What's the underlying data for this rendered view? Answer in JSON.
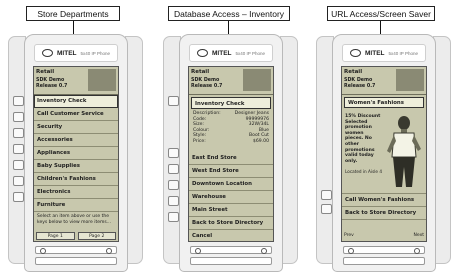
{
  "callouts": {
    "left": "Store Departments",
    "mid": "Database Access – Inventory",
    "right": "URL Access/Screen Saver"
  },
  "brand": {
    "logo": "MITEL",
    "model": "5x40 IP Phone"
  },
  "phone1": {
    "header": {
      "title": "Retail",
      "line1": "SDK Demo",
      "line2": "Release 0.7"
    },
    "items": [
      "Inventory Check",
      "Call Customer Service",
      "Security",
      "Accessories",
      "Appliances",
      "Baby Supplies",
      "Children's Fashions",
      "Electronics",
      "Furniture"
    ],
    "note": "Select an item above or use the keys below to view more items...",
    "page1": "Page 1",
    "page2": "Page 2"
  },
  "phone2": {
    "header": {
      "title": "Retail",
      "line1": "SDK Demo",
      "line2": "Release 0.7"
    },
    "detail_title": "Inventory Check",
    "detail": {
      "description_label": "Description:",
      "description": "Designer Jeans",
      "code_label": "Code:",
      "code": "99999976",
      "size_label": "Size:",
      "size": "32W/34L",
      "colour_label": "Colour:",
      "colour": "Blue",
      "style_label": "Style:",
      "style": "Boot Cut",
      "price_label": "Price:",
      "price": "$69.00"
    },
    "items": [
      "East End Store",
      "West End Store",
      "Downtown Location",
      "Warehouse",
      "Main Street",
      "Back to Store Directory",
      "Cancel"
    ]
  },
  "phone3": {
    "header": {
      "title": "Retail",
      "line1": "SDK Demo",
      "line2": "Release 0.7"
    },
    "promo_title": "Women's Fashions",
    "promo_text": "15% Discount Selected promotion women pieces. No other promotions valid today only.",
    "promo_foot": "Located in Aisle 4",
    "items": [
      "Call Women's Fashions",
      "Back to Store Directory"
    ],
    "soft_prev": "Prev",
    "soft_next": "Next"
  }
}
